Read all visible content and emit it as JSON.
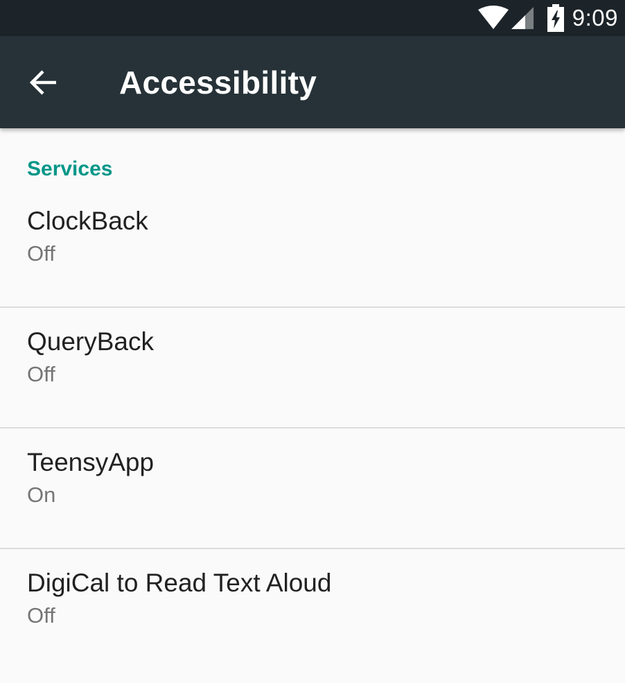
{
  "status_bar": {
    "time": "9:09",
    "icons": [
      "wifi-icon",
      "cell-signal-icon",
      "battery-charging-icon"
    ]
  },
  "app_bar": {
    "back_icon": "arrow-back-icon",
    "title": "Accessibility"
  },
  "colors": {
    "status_bar_bg": "#1d2429",
    "app_bar_bg": "#263238",
    "accent": "#009688",
    "background": "#fafafa"
  },
  "services": {
    "header": "Services",
    "items": [
      {
        "title": "ClockBack",
        "summary": "Off"
      },
      {
        "title": "QueryBack",
        "summary": "Off"
      },
      {
        "title": "TeensyApp",
        "summary": "On"
      },
      {
        "title": "DigiCal to Read Text Aloud",
        "summary": "Off"
      }
    ]
  }
}
